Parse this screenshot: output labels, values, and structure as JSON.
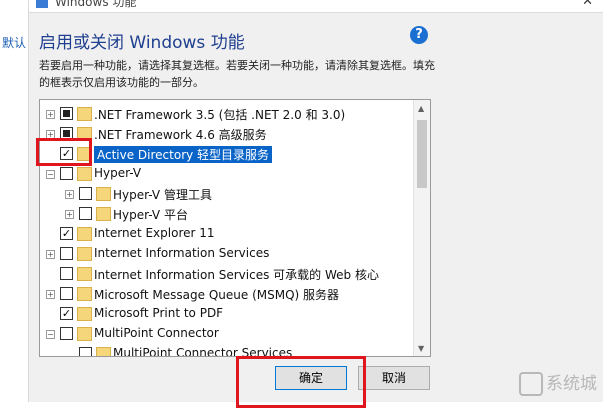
{
  "left_strip": {
    "hint": "默认"
  },
  "window": {
    "title": "Windows 功能",
    "close_glyph": "✕"
  },
  "heading": "启用或关闭 Windows 功能",
  "help_glyph": "?",
  "description": "若要启用一种功能，请选择其复选框。若要关闭一种功能，请清除其复选框。填充的框表示仅启用该功能的一部分。",
  "features": [
    {
      "label": ".NET Framework 3.5 (包括 .NET 2.0 和 3.0)",
      "state": "partial",
      "expander": "+",
      "indent": 0
    },
    {
      "label": ".NET Framework 4.6 高级服务",
      "state": "partial",
      "expander": "+",
      "indent": 0
    },
    {
      "label": "Active Directory 轻型目录服务",
      "state": "checked",
      "expander": "",
      "indent": 0,
      "selected": true
    },
    {
      "label": "Hyper-V",
      "state": "unchecked",
      "expander": "−",
      "indent": 0
    },
    {
      "label": "Hyper-V 管理工具",
      "state": "unchecked",
      "expander": "+",
      "indent": 1
    },
    {
      "label": "Hyper-V 平台",
      "state": "unchecked",
      "expander": "+",
      "indent": 1
    },
    {
      "label": "Internet Explorer 11",
      "state": "checked",
      "expander": "",
      "indent": 0
    },
    {
      "label": "Internet Information Services",
      "state": "unchecked",
      "expander": "+",
      "indent": 0
    },
    {
      "label": "Internet Information Services 可承载的 Web 核心",
      "state": "unchecked",
      "expander": "",
      "indent": 0
    },
    {
      "label": "Microsoft Message Queue (MSMQ) 服务器",
      "state": "unchecked",
      "expander": "+",
      "indent": 0
    },
    {
      "label": "Microsoft Print to PDF",
      "state": "checked",
      "expander": "",
      "indent": 0
    },
    {
      "label": "MultiPoint Connector",
      "state": "unchecked",
      "expander": "−",
      "indent": 0
    },
    {
      "label": "MultiPoint Connector Services",
      "state": "unchecked",
      "expander": "",
      "indent": 1
    }
  ],
  "buttons": {
    "ok": "确定",
    "cancel": "取消"
  },
  "watermark": "系统城",
  "colors": {
    "highlight": "#e0161e",
    "selection": "#0a64c8",
    "heading": "#1f3f8f"
  }
}
